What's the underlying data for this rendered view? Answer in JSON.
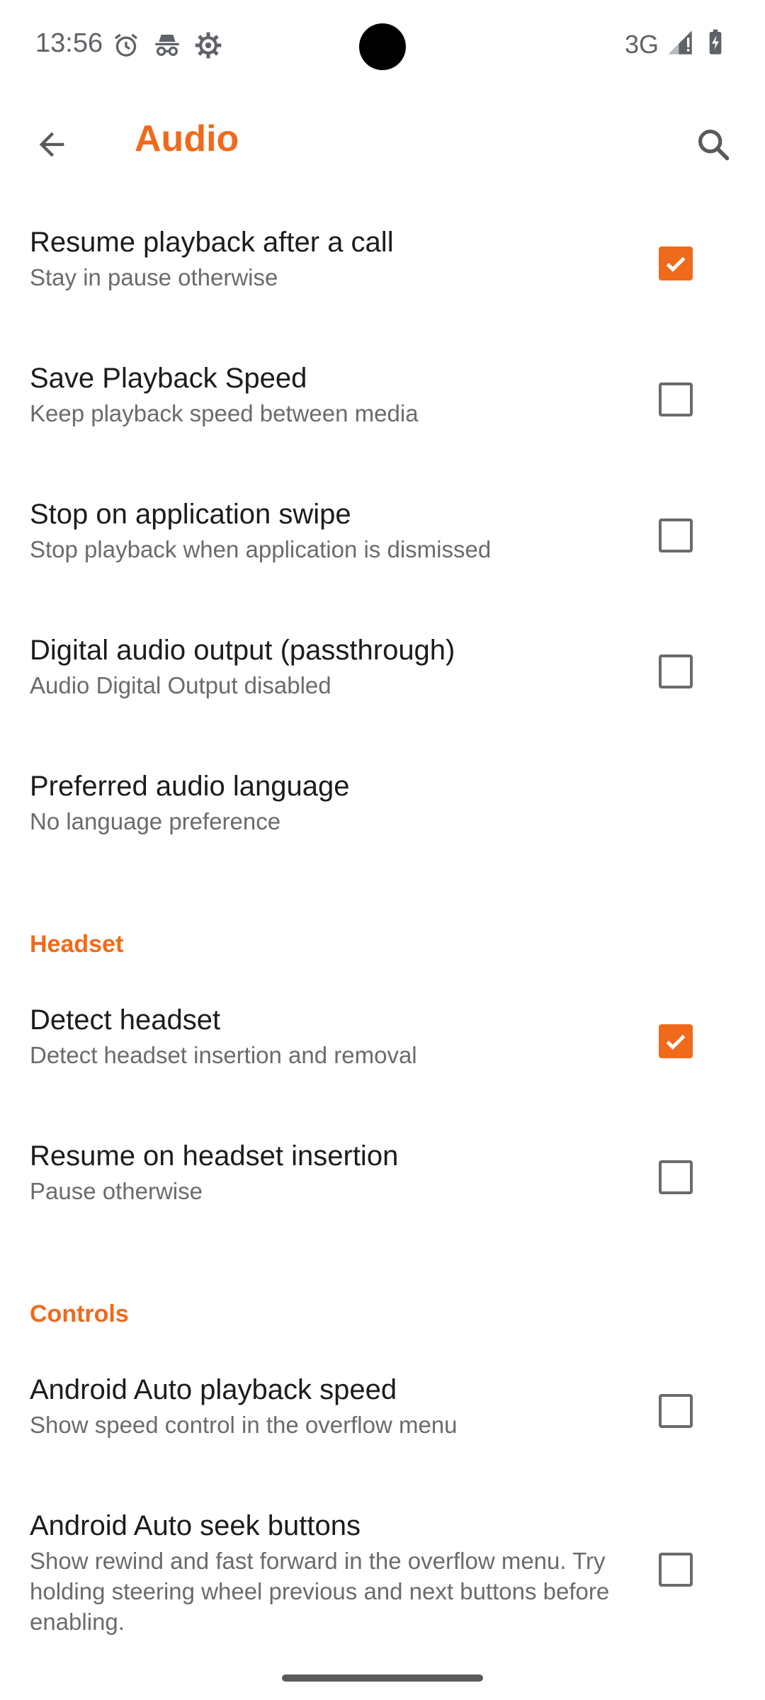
{
  "status_bar": {
    "time": "13:56",
    "network_type": "3G",
    "icons": [
      "alarm-icon",
      "incognito-icon",
      "settings-gear-icon",
      "signal-icon",
      "battery-charging-icon"
    ]
  },
  "app_bar": {
    "title": "Audio",
    "back_icon": "arrow-left-icon",
    "search_icon": "search-icon"
  },
  "colors": {
    "accent": "#f06a1b",
    "text_primary": "#1c1c1c",
    "text_secondary": "#6b6b6b"
  },
  "preferences": [
    {
      "title": "Resume playback after a call",
      "summary": "Stay in pause otherwise",
      "checked": true
    },
    {
      "title": "Save Playback Speed",
      "summary": "Keep playback speed between media",
      "checked": false
    },
    {
      "title": "Stop on application swipe",
      "summary": "Stop playback when application is dismissed",
      "checked": false
    },
    {
      "title": "Digital audio output (passthrough)",
      "summary": "Audio Digital Output disabled",
      "checked": false
    },
    {
      "title": "Preferred audio language",
      "summary": "No language preference"
    }
  ],
  "headset": {
    "header": "Headset",
    "items": [
      {
        "title": "Detect headset",
        "summary": "Detect headset insertion and removal",
        "checked": true
      },
      {
        "title": "Resume on headset insertion",
        "summary": "Pause otherwise",
        "checked": false
      }
    ]
  },
  "controls": {
    "header": "Controls",
    "items": [
      {
        "title": "Android Auto playback speed",
        "summary": "Show speed control in the overflow menu",
        "checked": false
      },
      {
        "title": "Android Auto seek buttons",
        "summary": "Show rewind and fast forward in the overflow menu. Try holding steering wheel previous and next buttons before enabling.",
        "checked": false
      }
    ]
  }
}
